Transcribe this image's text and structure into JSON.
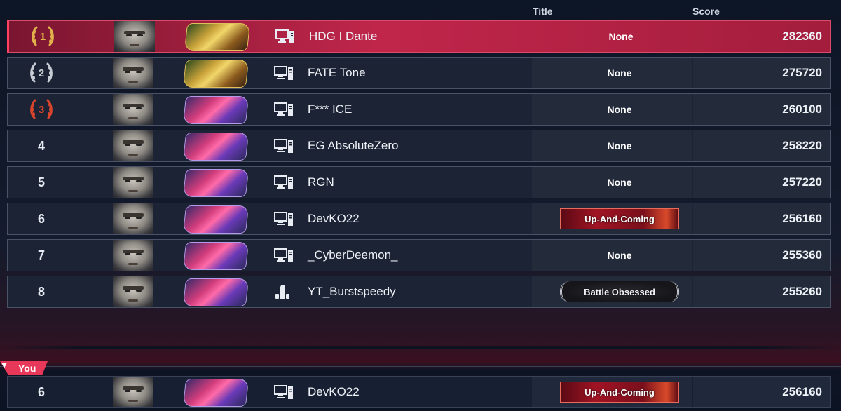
{
  "columns": {
    "title": "Title",
    "score": "Score"
  },
  "rows": [
    {
      "rank": "1",
      "medal": "gold",
      "badge": "gold",
      "platform": "pc-icon",
      "name": "HDG I Dante",
      "title": "None",
      "title_style": "none",
      "score": "282360",
      "highlight": true
    },
    {
      "rank": "2",
      "medal": "silver",
      "badge": "gold",
      "platform": "pc-icon",
      "name": "FATE Tone",
      "title": "None",
      "title_style": "none",
      "score": "275720",
      "highlight": false
    },
    {
      "rank": "3",
      "medal": "bronze",
      "badge": "pink",
      "platform": "pc-icon",
      "name": "F*** ICE",
      "title": "None",
      "title_style": "none",
      "score": "260100",
      "highlight": false
    },
    {
      "rank": "4",
      "medal": "",
      "badge": "pink",
      "platform": "pc-icon",
      "name": "EG AbsoluteZero",
      "title": "None",
      "title_style": "none",
      "score": "258220",
      "highlight": false
    },
    {
      "rank": "5",
      "medal": "",
      "badge": "pink",
      "platform": "pc-icon",
      "name": "RGN",
      "title": "None",
      "title_style": "none",
      "score": "257220",
      "highlight": false
    },
    {
      "rank": "6",
      "medal": "",
      "badge": "pink",
      "platform": "pc-icon",
      "name": "DevKO22",
      "title": "Up-And-Coming",
      "title_style": "red",
      "score": "256160",
      "highlight": false
    },
    {
      "rank": "7",
      "medal": "",
      "badge": "pink",
      "platform": "pc-icon",
      "name": "_CyberDeemon_",
      "title": "None",
      "title_style": "none",
      "score": "255360",
      "highlight": false
    },
    {
      "rank": "8",
      "medal": "",
      "badge": "pink",
      "platform": "console-icon",
      "name": "YT_Burstspeedy",
      "title": "Battle Obsessed",
      "title_style": "silver",
      "score": "255260",
      "highlight": false
    }
  ],
  "you": {
    "tag": "You",
    "rank": "6",
    "badge": "pink",
    "platform": "pc-icon",
    "name": "DevKO22",
    "title": "Up-And-Coming",
    "title_style": "red",
    "score": "256160"
  },
  "colors": {
    "highlight": "#c0264a",
    "gold": "#e2b24a",
    "silver": "#c8ccd4",
    "bronze": "#d8452c",
    "you": "#e8385a"
  }
}
